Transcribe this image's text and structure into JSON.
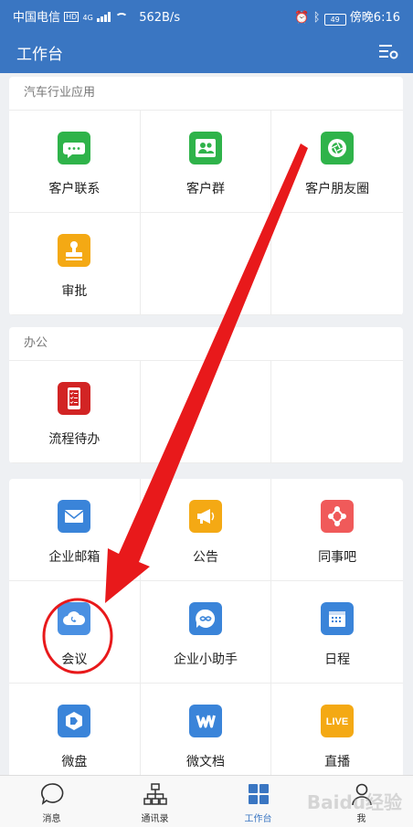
{
  "status_bar": {
    "carrier": "中国电信",
    "hd": "HD",
    "network": "4G",
    "speed": "562B/s",
    "battery": "49",
    "time": "傍晚6:16"
  },
  "header": {
    "title": "工作台",
    "settings_icon": "settings-list-icon"
  },
  "sections": {
    "auto": {
      "title": "汽车行业应用",
      "items": [
        {
          "label": "客户联系",
          "icon": "chat-bubble-icon",
          "color": "#2fb34a"
        },
        {
          "label": "客户群",
          "icon": "group-users-icon",
          "color": "#2fb34a"
        },
        {
          "label": "客户朋友圈",
          "icon": "camera-shutter-icon",
          "color": "#2fb34a"
        },
        {
          "label": "审批",
          "icon": "stamp-icon",
          "color": "#f4a914"
        }
      ]
    },
    "office": {
      "title": "办公",
      "items": [
        {
          "label": "流程待办",
          "icon": "phone-checklist-icon",
          "color": "#d22424"
        }
      ]
    },
    "apps": {
      "items": [
        {
          "label": "企业邮箱",
          "icon": "mail-icon",
          "color": "#3a84d9"
        },
        {
          "label": "公告",
          "icon": "megaphone-icon",
          "color": "#f4a914"
        },
        {
          "label": "同事吧",
          "icon": "network-icon",
          "color": "#f05a5a"
        },
        {
          "label": "会议",
          "icon": "cloud-phone-icon",
          "color": "#4a90e2"
        },
        {
          "label": "企业小助手",
          "icon": "assistant-bubble-icon",
          "color": "#3a84d9"
        },
        {
          "label": "日程",
          "icon": "calendar-icon",
          "color": "#3a84d9"
        },
        {
          "label": "微盘",
          "icon": "drive-icon",
          "color": "#3a84d9"
        },
        {
          "label": "微文档",
          "icon": "w-document-icon",
          "color": "#3a84d9"
        },
        {
          "label": "直播",
          "icon": "live-icon",
          "color": "#f4a914",
          "badge": "LIVE"
        }
      ]
    }
  },
  "tabs": [
    {
      "label": "消息",
      "icon": "message-bubble-icon"
    },
    {
      "label": "通讯录",
      "icon": "org-chart-icon"
    },
    {
      "label": "工作台",
      "icon": "grid-icon",
      "active": true
    },
    {
      "label": "我",
      "icon": "person-icon"
    }
  ],
  "annotation": {
    "color": "#e8191b"
  },
  "watermark": "Baidu经验"
}
